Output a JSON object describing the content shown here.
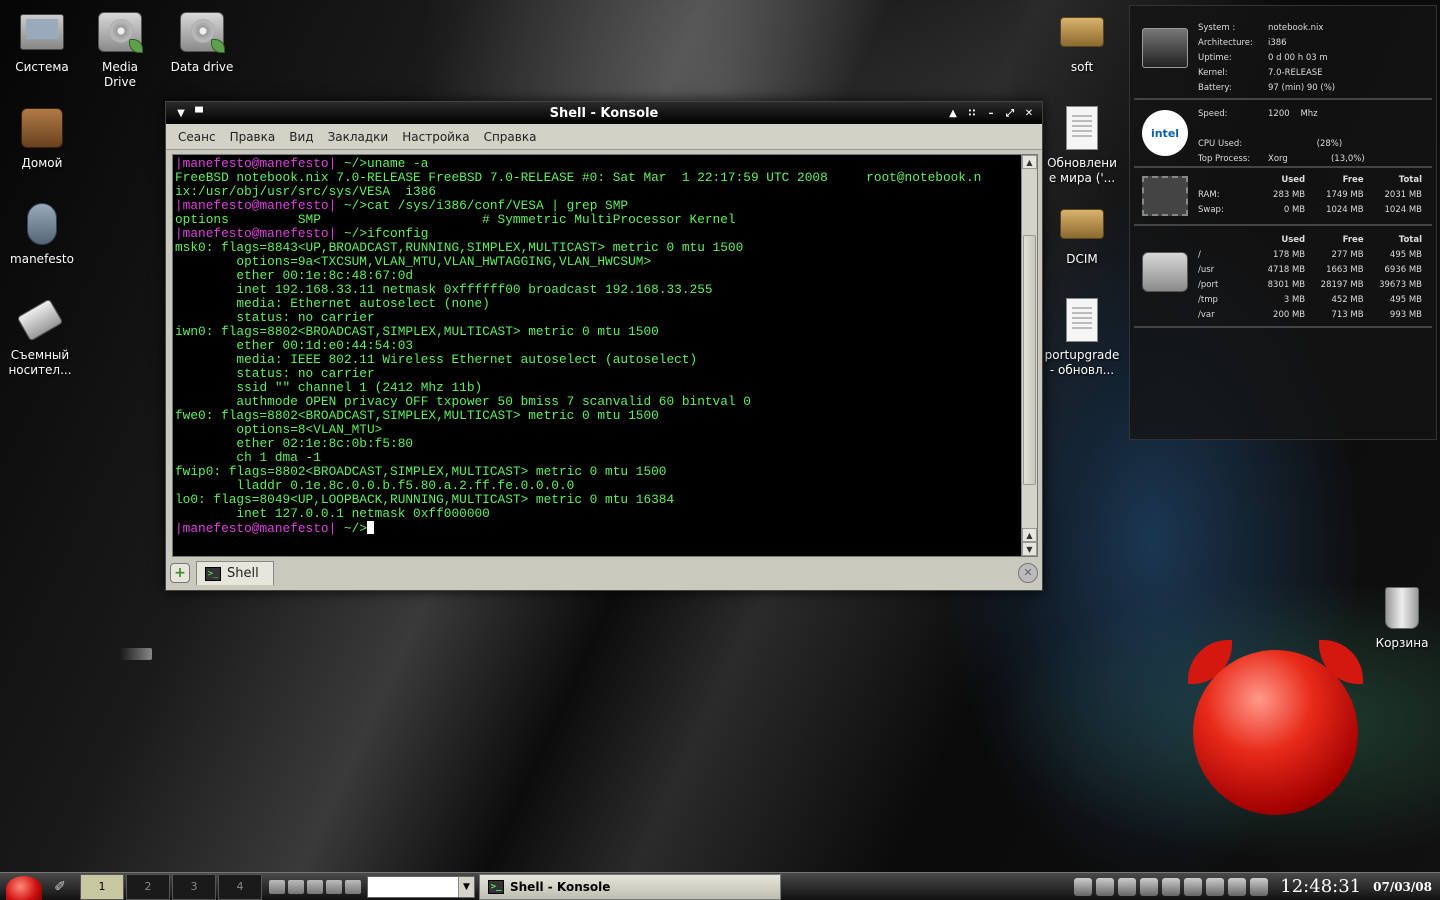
{
  "desktop_icons": {
    "system": "Система",
    "media_drive": "Media\nDrive",
    "data_drive": "Data drive",
    "home": "Домой",
    "user": "manefesto",
    "removable": "Съемный\nносител...",
    "soft": "soft",
    "updates": "Обновлени\nе мира ('...",
    "dcim": "DCIM",
    "portupgrade": "portupgrade\n- обновл...",
    "trash": "Корзина"
  },
  "konsole": {
    "title": "Shell - Konsole",
    "menu": [
      "Сеанс",
      "Правка",
      "Вид",
      "Закладки",
      "Настройка",
      "Справка"
    ],
    "tab_label": "Shell",
    "lines": [
      {
        "prompt": "|manefesto@manefesto|",
        "text": " ~/>uname -a"
      },
      {
        "prompt": "",
        "text": "FreeBSD notebook.nix 7.0-RELEASE FreeBSD 7.0-RELEASE #0: Sat Mar  1 22:17:59 UTC 2008     root@notebook.n"
      },
      {
        "prompt": "",
        "text": "ix:/usr/obj/usr/src/sys/VESA  i386"
      },
      {
        "prompt": "|manefesto@manefesto|",
        "text": " ~/>cat /sys/i386/conf/VESA | grep SMP"
      },
      {
        "prompt": "",
        "text": "options         SMP                     # Symmetric MultiProcessor Kernel"
      },
      {
        "prompt": "|manefesto@manefesto|",
        "text": " ~/>ifconfig"
      },
      {
        "prompt": "",
        "text": "msk0: flags=8843<UP,BROADCAST,RUNNING,SIMPLEX,MULTICAST> metric 0 mtu 1500"
      },
      {
        "prompt": "",
        "text": "        options=9a<TXCSUM,VLAN_MTU,VLAN_HWTAGGING,VLAN_HWCSUM>"
      },
      {
        "prompt": "",
        "text": "        ether 00:1e:8c:48:67:0d"
      },
      {
        "prompt": "",
        "text": "        inet 192.168.33.11 netmask 0xffffff00 broadcast 192.168.33.255"
      },
      {
        "prompt": "",
        "text": "        media: Ethernet autoselect (none)"
      },
      {
        "prompt": "",
        "text": "        status: no carrier"
      },
      {
        "prompt": "",
        "text": "iwn0: flags=8802<BROADCAST,SIMPLEX,MULTICAST> metric 0 mtu 1500"
      },
      {
        "prompt": "",
        "text": "        ether 00:1d:e0:44:54:03"
      },
      {
        "prompt": "",
        "text": "        media: IEEE 802.11 Wireless Ethernet autoselect (autoselect)"
      },
      {
        "prompt": "",
        "text": "        status: no carrier"
      },
      {
        "prompt": "",
        "text": "        ssid \"\" channel 1 (2412 Mhz 11b)"
      },
      {
        "prompt": "",
        "text": "        authmode OPEN privacy OFF txpower 50 bmiss 7 scanvalid 60 bintval 0"
      },
      {
        "prompt": "",
        "text": "fwe0: flags=8802<BROADCAST,SIMPLEX,MULTICAST> metric 0 mtu 1500"
      },
      {
        "prompt": "",
        "text": "        options=8<VLAN_MTU>"
      },
      {
        "prompt": "",
        "text": "        ether 02:1e:8c:0b:f5:80"
      },
      {
        "prompt": "",
        "text": "        ch 1 dma -1"
      },
      {
        "prompt": "",
        "text": "fwip0: flags=8802<BROADCAST,SIMPLEX,MULTICAST> metric 0 mtu 1500"
      },
      {
        "prompt": "",
        "text": "        lladdr 0.1e.8c.0.0.b.f5.80.a.2.ff.fe.0.0.0.0"
      },
      {
        "prompt": "",
        "text": "lo0: flags=8049<UP,LOOPBACK,RUNNING,MULTICAST> metric 0 mtu 16384"
      },
      {
        "prompt": "",
        "text": "        inet 127.0.0.1 netmask 0xff000000"
      },
      {
        "prompt": "|manefesto@manefesto|",
        "text": " ~/>",
        "cursor": true
      }
    ]
  },
  "sysinfo": {
    "system": [
      {
        "k": "System :",
        "v": "notebook.nix"
      },
      {
        "k": "Architecture:",
        "v": "i386"
      },
      {
        "k": "Uptime:",
        "v": "0 d 00 h 03 m"
      },
      {
        "k": "Kernel:",
        "v": "7.0-RELEASE"
      },
      {
        "k": "Battery:",
        "v": "97 (min) 90 (%)"
      }
    ],
    "cpu": [
      {
        "k": "Speed:",
        "v": "1200    Mhz"
      },
      {
        "k": "",
        "v": ""
      },
      {
        "k": "CPU Used:",
        "v": "                  (28%)"
      },
      {
        "k": "Top Process:",
        "v": "Xorg                (13,0%)"
      }
    ],
    "intel_label": "intel",
    "mem_header": [
      "",
      "Used",
      "Free",
      "Total"
    ],
    "mem": [
      [
        "RAM:",
        "283 MB",
        "1749 MB",
        "2031 MB"
      ],
      [
        "Swap:",
        "0 MB",
        "1024 MB",
        "1024 MB"
      ]
    ],
    "disk_header": [
      "",
      "Used",
      "Free",
      "Total"
    ],
    "disk": [
      [
        "/",
        "178 MB",
        "277 MB",
        "495 MB"
      ],
      [
        "/usr",
        "4718 MB",
        "1663 MB",
        "6936 MB"
      ],
      [
        "/port",
        "8301 MB",
        "28197 MB",
        "39673 MB"
      ],
      [
        "/tmp",
        "3 MB",
        "452 MB",
        "495 MB"
      ],
      [
        "/var",
        "200 MB",
        "713 MB",
        "993 MB"
      ]
    ]
  },
  "taskbar": {
    "desktops": [
      "1",
      "2",
      "3",
      "4"
    ],
    "active_task": "Shell - Konsole",
    "clock": "12:48:31",
    "date": "07/03/08"
  }
}
